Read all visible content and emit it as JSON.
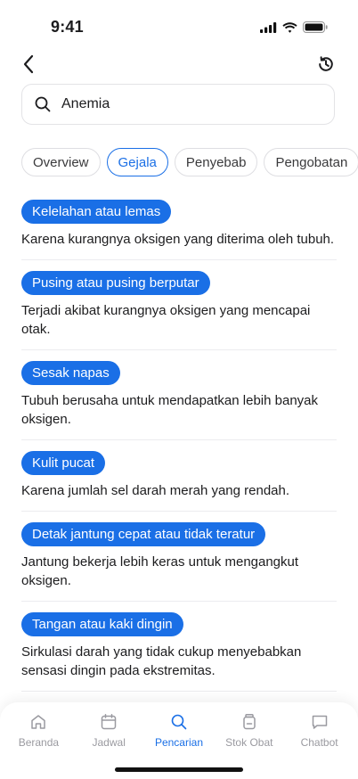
{
  "status_bar": {
    "time": "9:41"
  },
  "search": {
    "value": "Anemia"
  },
  "tabs": [
    {
      "label": "Overview"
    },
    {
      "label": "Gejala"
    },
    {
      "label": "Penyebab"
    },
    {
      "label": "Pengobatan"
    }
  ],
  "active_tab": "Gejala",
  "symptoms": [
    {
      "title": "Kelelahan atau lemas",
      "description": "Karena kurangnya oksigen yang diterima oleh tubuh."
    },
    {
      "title": "Pusing atau pusing berputar",
      "description": "Terjadi akibat kurangnya oksigen yang mencapai otak."
    },
    {
      "title": "Sesak napas",
      "description": "Tubuh berusaha untuk mendapatkan lebih banyak oksigen."
    },
    {
      "title": "Kulit pucat",
      "description": "Karena jumlah sel darah merah yang rendah."
    },
    {
      "title": "Detak jantung cepat atau tidak teratur",
      "description": "Jantung bekerja lebih keras untuk mengangkut oksigen."
    },
    {
      "title": "Tangan atau kaki dingin",
      "description": "Sirkulasi darah yang tidak cukup menyebabkan sensasi dingin pada ekstremitas."
    }
  ],
  "bottom_nav": [
    {
      "label": "Beranda",
      "icon": "home-icon"
    },
    {
      "label": "Jadwal",
      "icon": "calendar-icon"
    },
    {
      "label": "Pencarian",
      "icon": "search-icon"
    },
    {
      "label": "Stok Obat",
      "icon": "medicine-stock-icon"
    },
    {
      "label": "Chatbot",
      "icon": "chat-icon"
    }
  ],
  "colors": {
    "accent": "#1a6fe6",
    "inactive": "#9a9aa0"
  }
}
